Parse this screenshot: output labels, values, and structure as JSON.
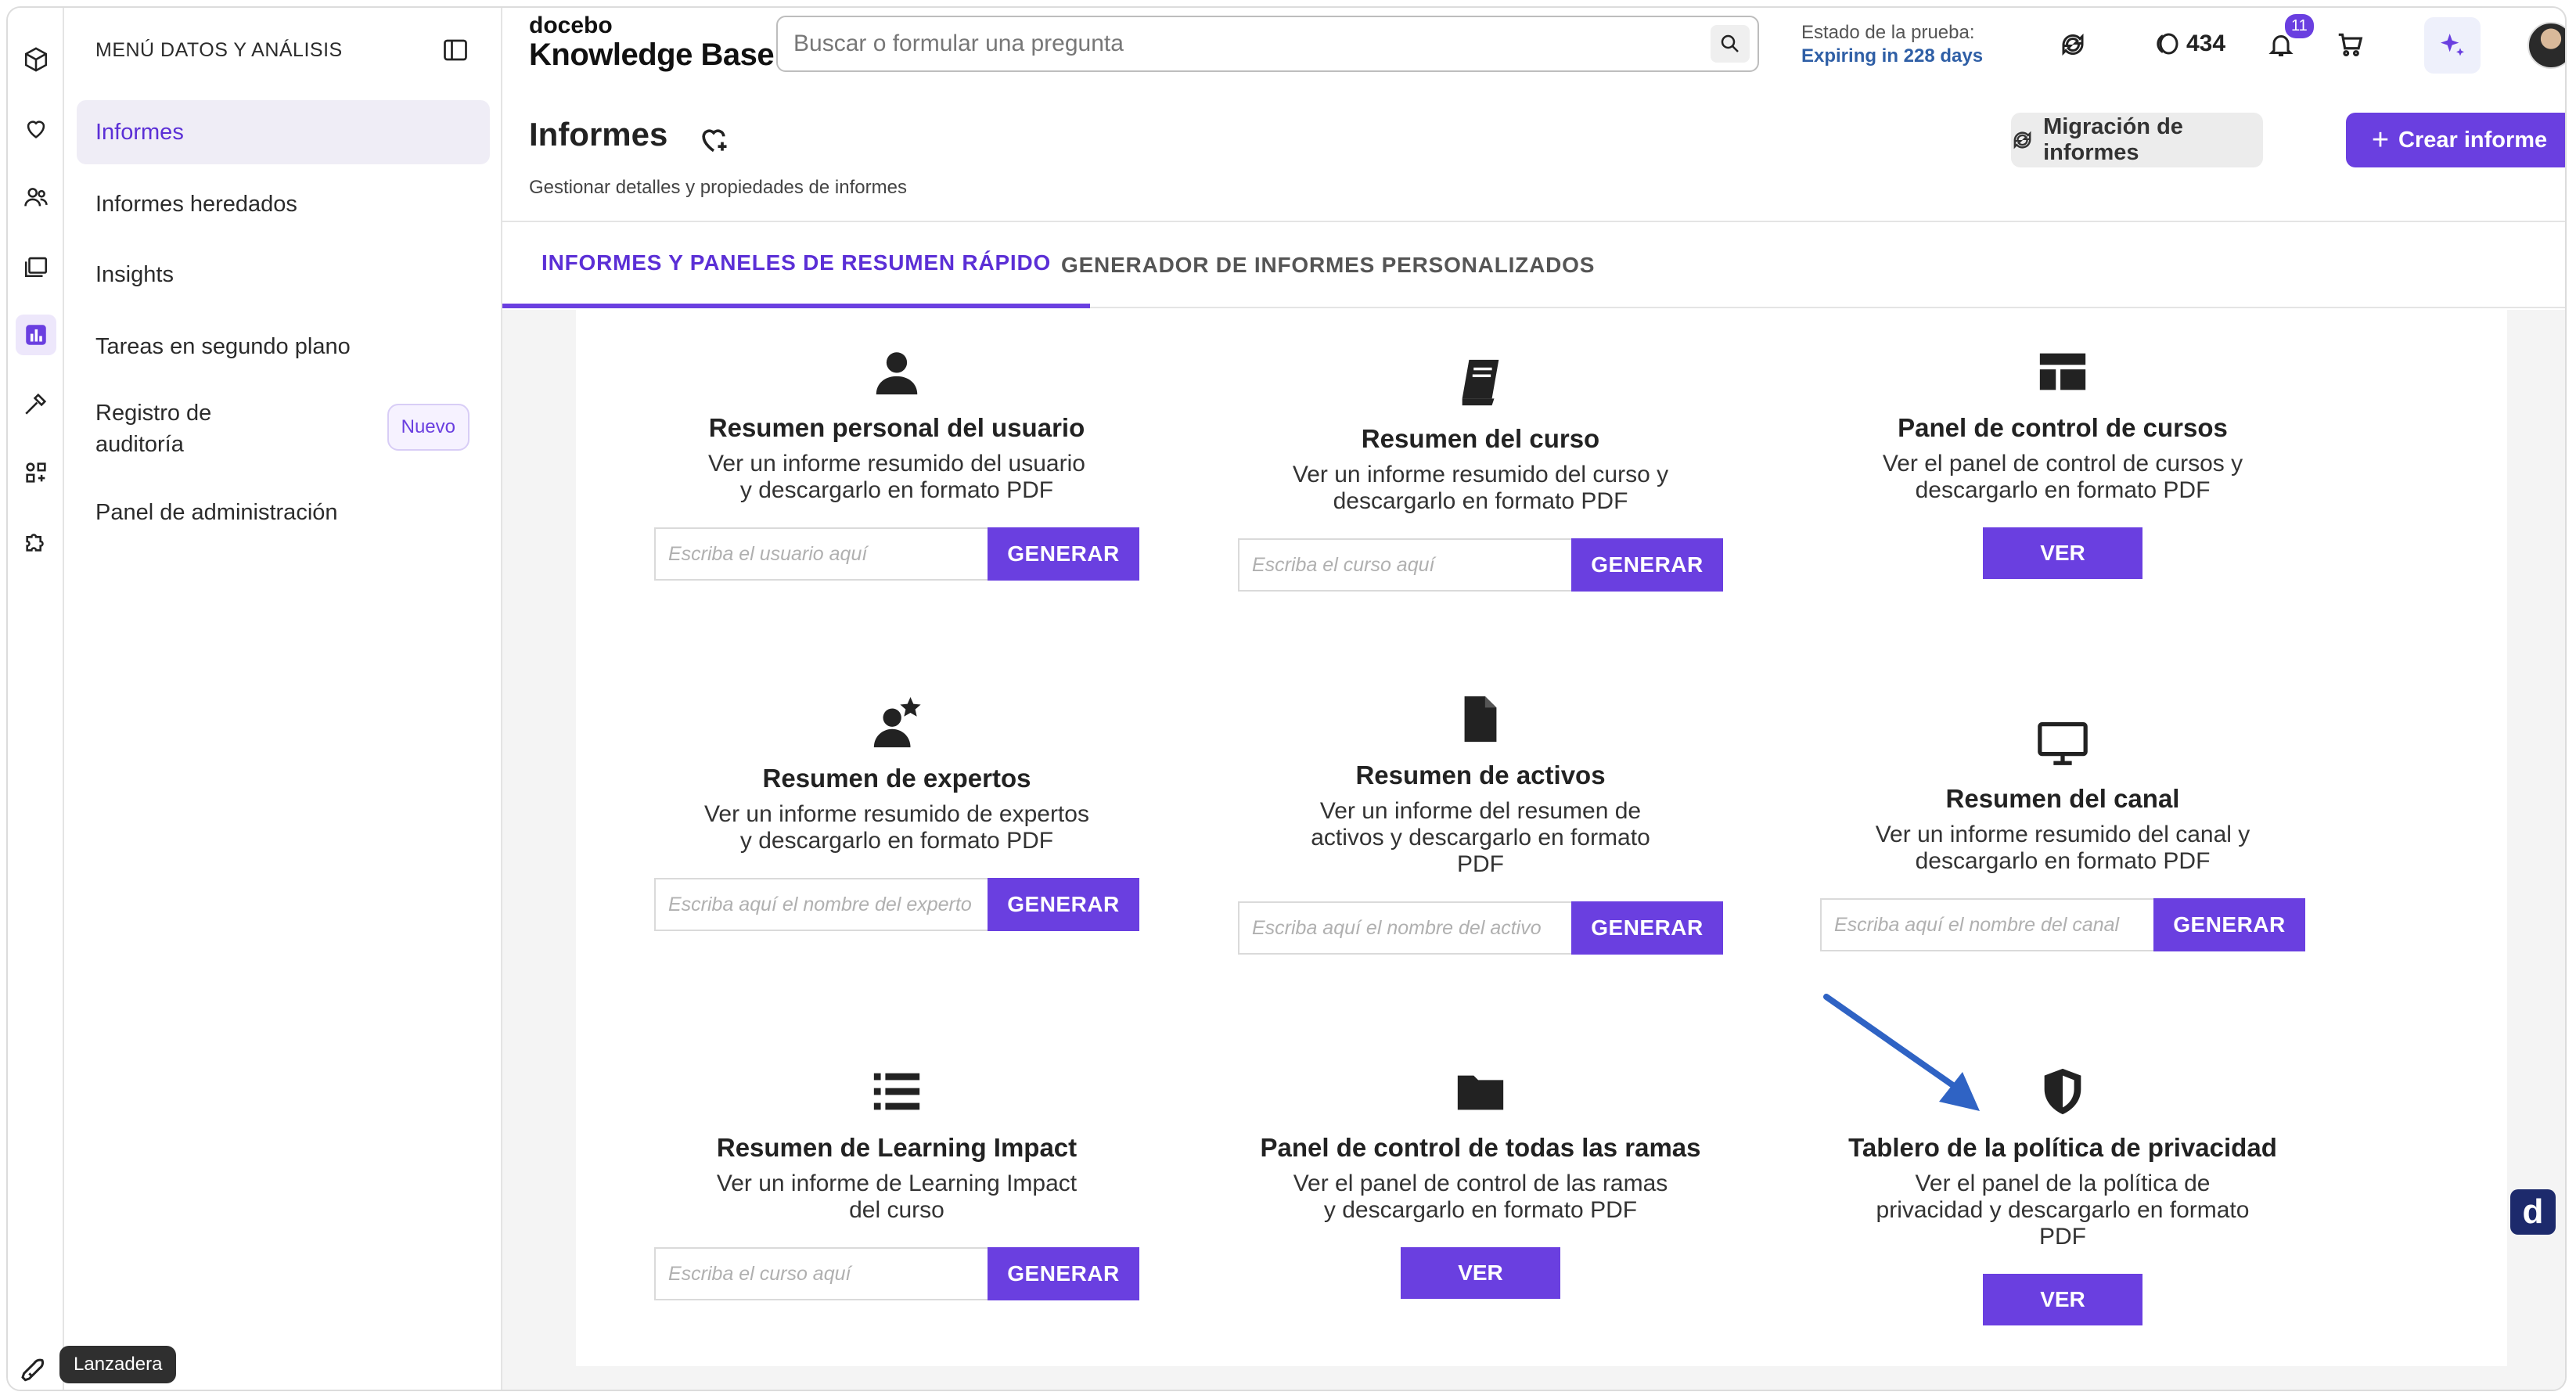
{
  "colors": {
    "accent": "#6a3fe0",
    "active_bg": "#efedf6",
    "arrow": "#2f63c4"
  },
  "sidebar": {
    "title": "MENÚ DATOS Y ANÁLISIS",
    "items": [
      {
        "label": "Informes",
        "active": true
      },
      {
        "label": "Informes heredados"
      },
      {
        "label": "Insights"
      },
      {
        "label": "Tareas en segundo plano"
      },
      {
        "label": "Registro de auditoría",
        "badge": "Nuevo"
      },
      {
        "label": "Panel de administración"
      }
    ],
    "launcher_tooltip": "Lanzadera"
  },
  "rail_icons": [
    "cube-icon",
    "heart-icon",
    "users-icon",
    "courses-icon",
    "analytics-icon",
    "tools-icon",
    "apps-icon",
    "puzzle-icon"
  ],
  "topbar": {
    "logo_small": "docebo",
    "logo_big": "Knowledge Base",
    "search_placeholder": "Buscar o formular una pregunta",
    "trial_label": "Estado de la prueba:",
    "trial_value": "Expiring in 228 days",
    "coins": "434",
    "notifications": "11"
  },
  "page": {
    "title": "Informes",
    "subtitle": "Gestionar detalles y propiedades de informes",
    "migration_button": "Migración de informes",
    "create_button": "Crear informe"
  },
  "tabs": [
    {
      "label": "INFORMES Y PANELES DE RESUMEN RÁPIDO",
      "active": true
    },
    {
      "label": "GENERADOR DE INFORMES PERSONALIZADOS"
    }
  ],
  "cards": [
    {
      "title": "Resumen personal del usuario",
      "desc": "Ver un informe resumido del usuario y descargarlo en formato PDF",
      "placeholder": "Escriba el usuario aquí",
      "button": "GENERAR"
    },
    {
      "title": "Resumen del curso",
      "desc": "Ver un informe resumido del curso y descargarlo en formato PDF",
      "placeholder": "Escriba el curso aquí",
      "button": "GENERAR"
    },
    {
      "title": "Panel de control de cursos",
      "desc": "Ver el panel de control de cursos y descargarlo en formato PDF",
      "button": "VER"
    },
    {
      "title": "Resumen de expertos",
      "desc": "Ver un informe resumido de expertos y descargarlo en formato PDF",
      "placeholder": "Escriba aquí el nombre del experto",
      "button": "GENERAR"
    },
    {
      "title": "Resumen de activos",
      "desc": "Ver un informe del resumen de activos y descargarlo en formato PDF",
      "placeholder": "Escriba aquí el nombre del activo",
      "button": "GENERAR"
    },
    {
      "title": "Resumen del canal",
      "desc": "Ver un informe resumido del canal y descargarlo en formato PDF",
      "placeholder": "Escriba aquí el nombre del canal",
      "button": "GENERAR"
    },
    {
      "title": "Resumen de Learning Impact",
      "desc": "Ver un informe de Learning Impact del curso",
      "placeholder": "Escriba el curso aquí",
      "button": "GENERAR"
    },
    {
      "title": "Panel de control de todas las ramas",
      "desc": "Ver el panel de control de las ramas y descargarlo en formato PDF",
      "button": "VER"
    },
    {
      "title": "Tablero de la política de privacidad",
      "desc": "Ver el panel de la política de privacidad y descargarlo en formato PDF",
      "button": "VER"
    }
  ]
}
